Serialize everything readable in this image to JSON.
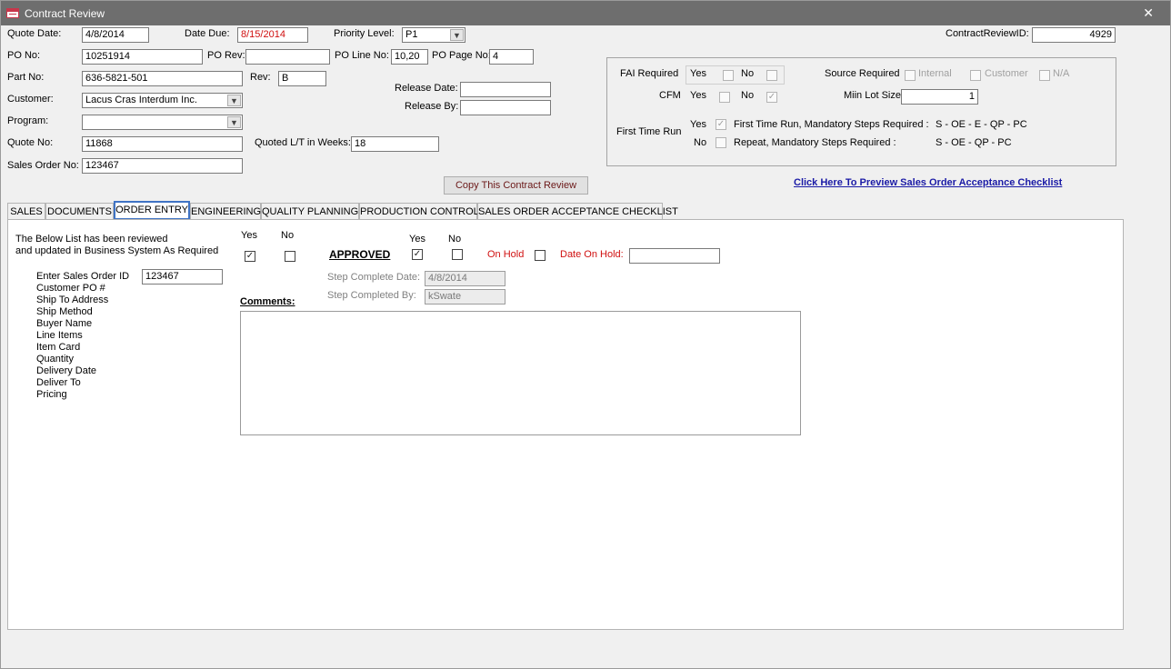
{
  "window": {
    "title": "Contract Review",
    "close_glyph": "✕"
  },
  "header": {
    "quote_date_label": "Quote Date:",
    "quote_date": "4/8/2014",
    "date_due_label": "Date Due:",
    "date_due": "8/15/2014",
    "priority_label": "Priority Level:",
    "priority": "P1",
    "crid_label": "ContractReviewID:",
    "crid": "4929",
    "po_no_label": "PO No:",
    "po_no": "10251914",
    "po_rev_label": "PO Rev:",
    "po_rev": "",
    "po_line_label": "PO Line No:",
    "po_line": "10,20",
    "po_page_label": "PO Page No:",
    "po_page": "4",
    "part_no_label": "Part No:",
    "part_no": "636-5821-501",
    "rev_label": "Rev:",
    "rev": "B",
    "customer_label": "Customer:",
    "customer": "Lacus Cras Interdum Inc.",
    "program_label": "Program:",
    "program": "",
    "quote_no_label": "Quote No:",
    "quote_no": "11868",
    "quoted_lt_label": "Quoted L/T in Weeks:",
    "quoted_lt": "18",
    "sales_order_label": "Sales Order No:",
    "sales_order": "123467",
    "release_date_label": "Release Date:",
    "release_date": "",
    "release_by_label": "Release By:",
    "release_by": "",
    "copy_button": "Copy This Contract Review",
    "preview_link": "Click Here To Preview Sales Order Acceptance Checklist"
  },
  "right_panel": {
    "fai_label": "FAI Required",
    "yes": "Yes",
    "no": "No",
    "cfm_label": "CFM",
    "first_time_run_label": "First Time Run",
    "ftr_yes_text": "First Time Run, Mandatory Steps Required :",
    "ftr_yes_steps": "S  -  OE   -  E  -  QP - PC",
    "ftr_no_text": "Repeat, Mandatory Steps Required :",
    "ftr_no_steps": "S  -  OE   -  QP - PC",
    "source_label": "Source Required",
    "source_internal": "Internal",
    "source_customer": "Customer",
    "source_na": "N/A",
    "min_lot_label": "Miin Lot Size",
    "min_lot": "1",
    "cfm_no_checked": true,
    "ftr_yes_checked": true
  },
  "tabs": [
    "SALES",
    "DOCUMENTS",
    "ORDER ENTRY",
    "ENGINEERING",
    "QUALITY PLANNING",
    "PRODUCTION CONTROL",
    "SALES ORDER ACCEPTANCE CHECKLIST"
  ],
  "active_tab": "ORDER ENTRY",
  "order_entry": {
    "intro_line1": "The Below List has been reviewed",
    "intro_line2": "and updated in Business System As Required",
    "yes": "Yes",
    "no": "No",
    "items": [
      "Enter Sales Order ID",
      "Customer PO #",
      "Ship To Address",
      "Ship Method",
      "Buyer Name",
      "Line Items",
      "Item Card",
      "Quantity",
      "Delivery Date",
      "Deliver To",
      "Pricing"
    ],
    "sales_order_id": "123467",
    "approved_label": "APPROVED",
    "on_hold_label": "On Hold",
    "date_on_hold_label": "Date On Hold:",
    "date_on_hold": "",
    "step_complete_date_label": "Step Complete Date:",
    "step_complete_date": "4/8/2014",
    "step_completed_by_label": "Step Completed By:",
    "step_completed_by": "kSwate",
    "comments_label": "Comments:",
    "comments": "",
    "reviewed_yes_checked": true,
    "approved_yes_checked": true,
    "check_glyph": "✓"
  }
}
